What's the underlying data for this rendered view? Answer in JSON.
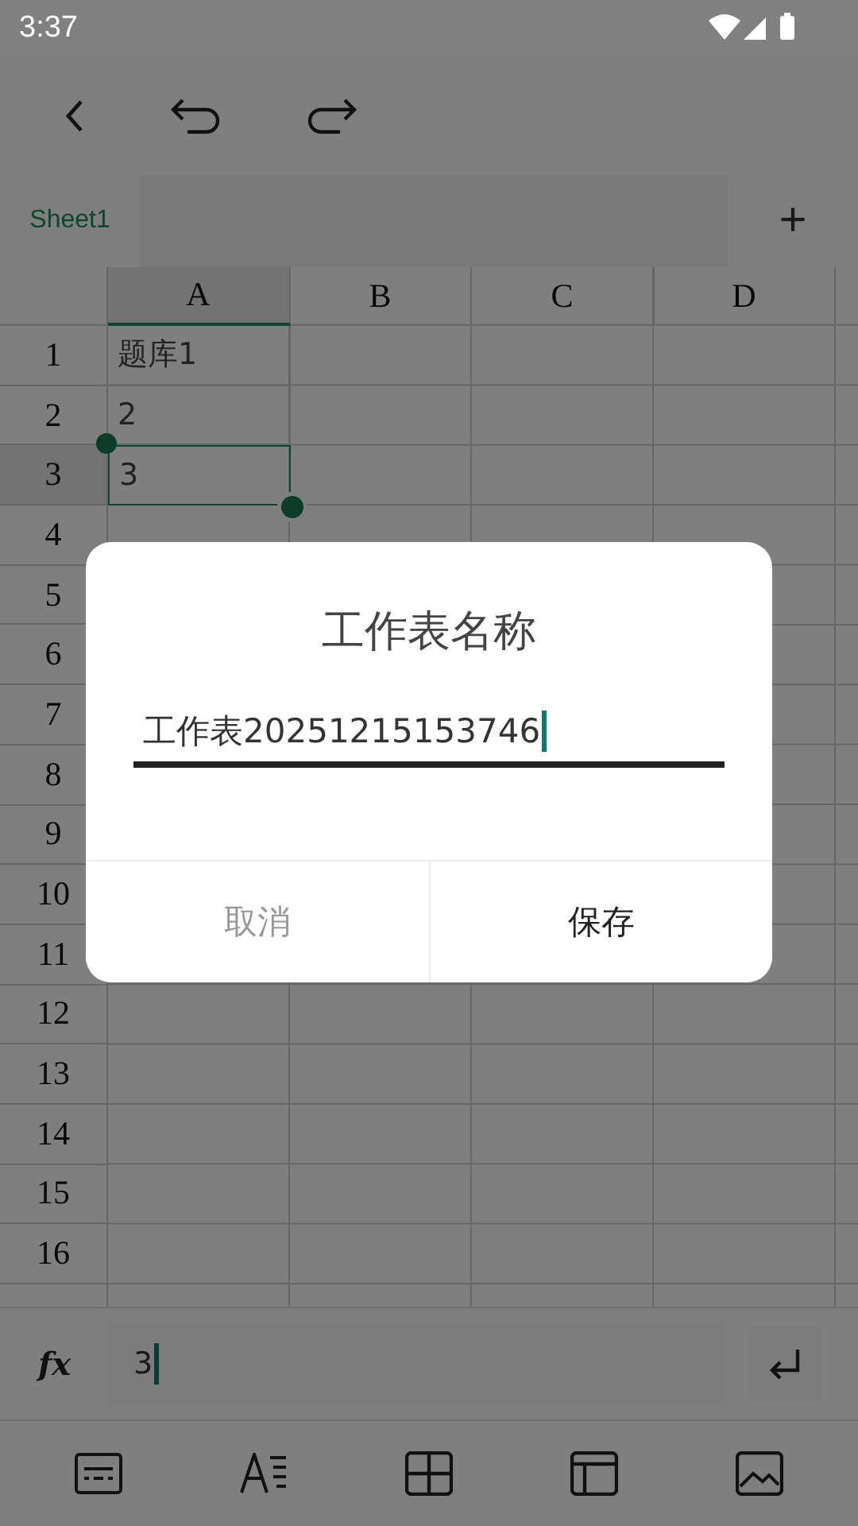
{
  "status_bar": {
    "time": "3:37"
  },
  "sheet_tabs": [
    {
      "label": "Sheet1",
      "selected": true
    }
  ],
  "add_sheet": "+",
  "grid": {
    "columns": [
      {
        "label": "A",
        "selected": true
      },
      {
        "label": "B",
        "selected": false
      },
      {
        "label": "C",
        "selected": false
      },
      {
        "label": "D",
        "selected": false
      }
    ],
    "rows": [
      {
        "label": "1",
        "selected": false,
        "cells": [
          "题库1",
          "",
          "",
          ""
        ]
      },
      {
        "label": "2",
        "selected": false,
        "cells": [
          "2",
          "",
          "",
          ""
        ]
      },
      {
        "label": "3",
        "selected": true,
        "cells": [
          "3",
          "",
          "",
          ""
        ]
      },
      {
        "label": "4",
        "selected": false,
        "cells": [
          "",
          "",
          "",
          ""
        ]
      },
      {
        "label": "5",
        "selected": false,
        "cells": [
          "",
          "",
          "",
          ""
        ]
      },
      {
        "label": "6",
        "selected": false,
        "cells": [
          "",
          "",
          "",
          ""
        ]
      },
      {
        "label": "7",
        "selected": false,
        "cells": [
          "",
          "",
          "",
          ""
        ]
      },
      {
        "label": "8",
        "selected": false,
        "cells": [
          "",
          "",
          "",
          ""
        ]
      },
      {
        "label": "9",
        "selected": false,
        "cells": [
          "",
          "",
          "",
          ""
        ]
      },
      {
        "label": "10",
        "selected": false,
        "cells": [
          "",
          "",
          "",
          ""
        ]
      },
      {
        "label": "11",
        "selected": false,
        "cells": [
          "",
          "",
          "",
          ""
        ]
      },
      {
        "label": "12",
        "selected": false,
        "cells": [
          "",
          "",
          "",
          ""
        ]
      },
      {
        "label": "13",
        "selected": false,
        "cells": [
          "",
          "",
          "",
          ""
        ]
      },
      {
        "label": "14",
        "selected": false,
        "cells": [
          "",
          "",
          "",
          ""
        ]
      },
      {
        "label": "15",
        "selected": false,
        "cells": [
          "",
          "",
          "",
          ""
        ]
      },
      {
        "label": "16",
        "selected": false,
        "cells": [
          "",
          "",
          "",
          ""
        ]
      }
    ]
  },
  "formula_bar": {
    "label": "fx",
    "value": "3"
  },
  "dialog": {
    "title": "工作表名称",
    "value": "工作表20251215153746",
    "buttons": [
      {
        "label": "取消",
        "disabled": true
      },
      {
        "label": "保存",
        "disabled": false
      }
    ]
  }
}
